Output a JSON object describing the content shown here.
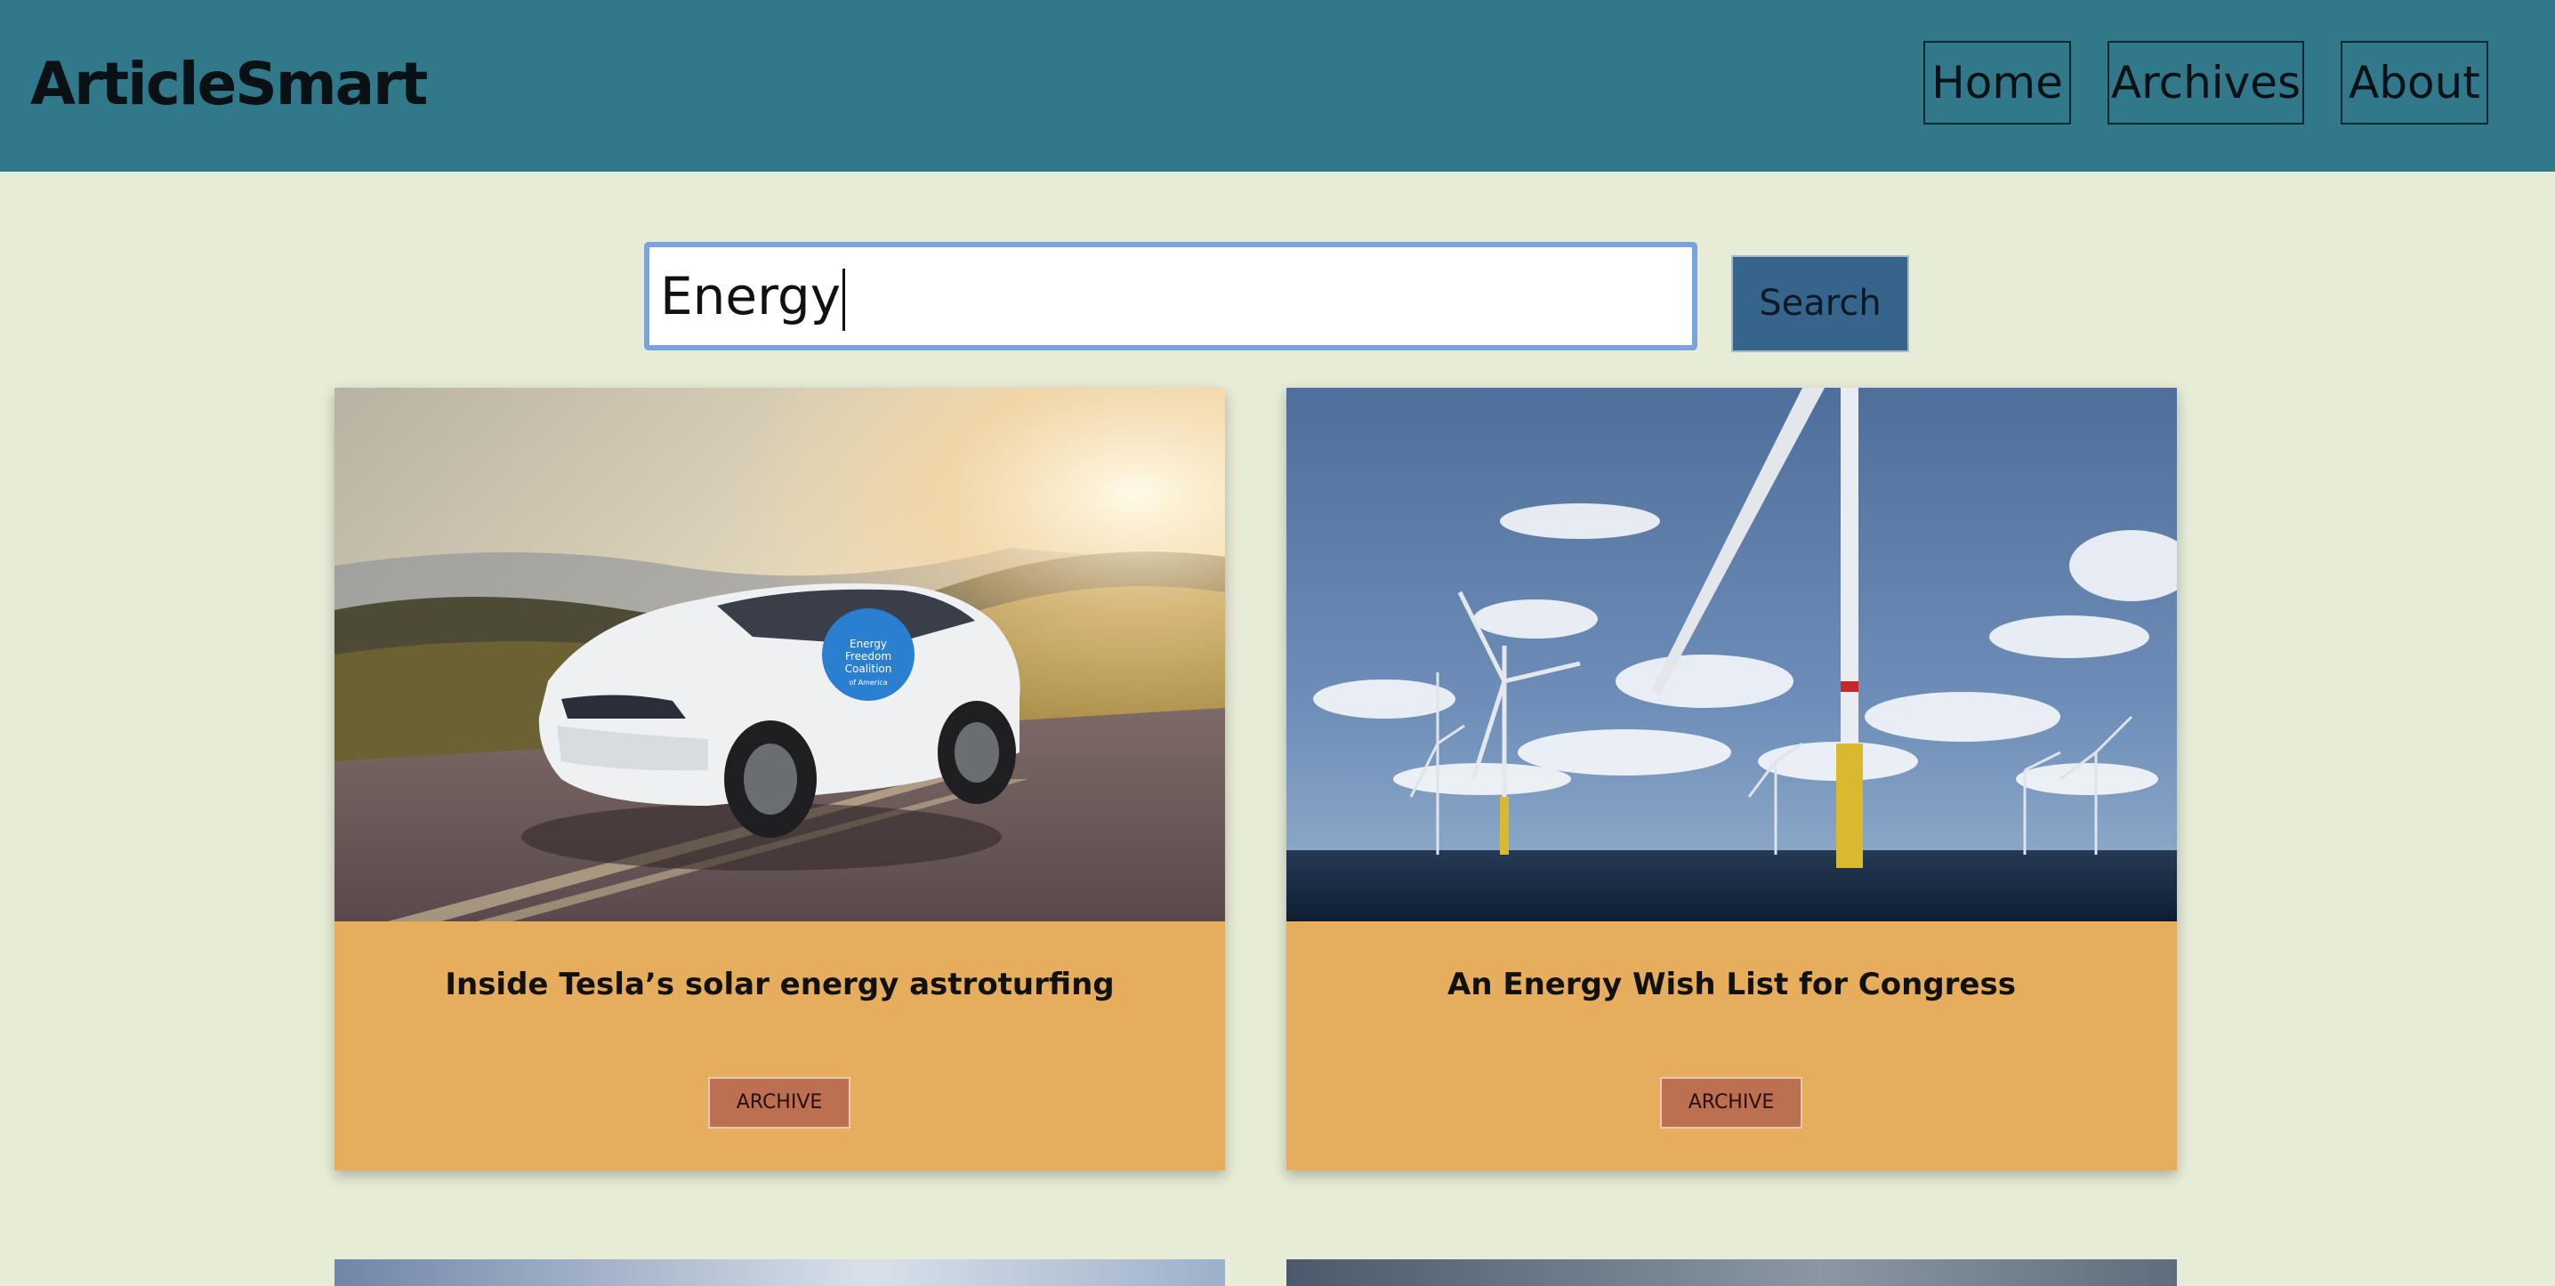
{
  "header": {
    "logo": "ArticleSmart",
    "nav": [
      {
        "label": "Home"
      },
      {
        "label": "Archives"
      },
      {
        "label": "About"
      }
    ]
  },
  "search": {
    "value": "Energy",
    "button_label": "Search"
  },
  "articles": [
    {
      "title": "Inside Tesla’s solar energy astroturfing",
      "button_label": "ARCHIVE",
      "image": "white-tesla-suv-on-road-photo",
      "decal": {
        "lines": [
          "Energy",
          "Freedom",
          "Coalition",
          "of America"
        ]
      }
    },
    {
      "title": "An Energy Wish List for Congress",
      "button_label": "ARCHIVE",
      "image": "offshore-wind-turbines-photo"
    }
  ],
  "colors": {
    "header_bg": "#31788b",
    "page_bg": "#e6ecd6",
    "card_bg": "#e6ae5c",
    "archive_btn": "#bd6f51",
    "search_btn": "#36648a"
  }
}
